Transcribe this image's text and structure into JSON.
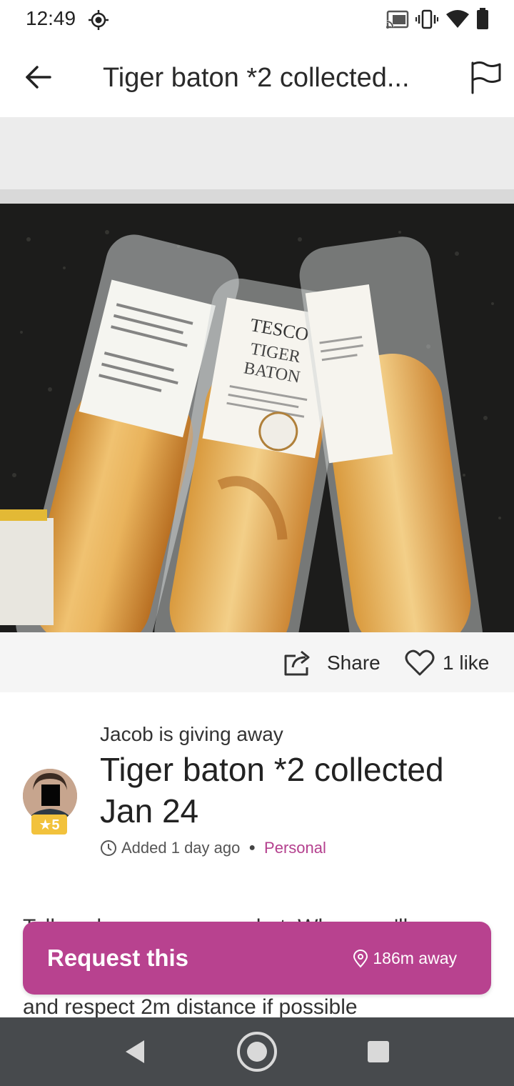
{
  "status_bar": {
    "time": "12:49",
    "icons": [
      "location-icon",
      "cast-icon",
      "vibrate-icon",
      "wifi-icon",
      "battery-icon"
    ]
  },
  "app_bar": {
    "title": "Tiger baton *2 collected...",
    "icons": [
      "back-arrow-icon",
      "flag-icon"
    ]
  },
  "photo": {
    "labels": [
      "TESCO",
      "TIGER",
      "BATON"
    ]
  },
  "actions": {
    "share_label": "Share",
    "like_label": "1 like"
  },
  "listing": {
    "giver_line": "Jacob is giving away",
    "title": "Tiger baton *2 collected Jan 24",
    "rating": "★5",
    "added": "Added 1 day ago",
    "tag": "Personal"
  },
  "description": "Tell me how many you what. When you'll message me but don't ring the bell. Wear a mask and respect 2m distance if possible",
  "request": {
    "label": "Request this",
    "distance": "186m away"
  },
  "colors": {
    "accent": "#b8428f",
    "nav_bar": "#474a4d",
    "rating": "#f2c23c"
  }
}
